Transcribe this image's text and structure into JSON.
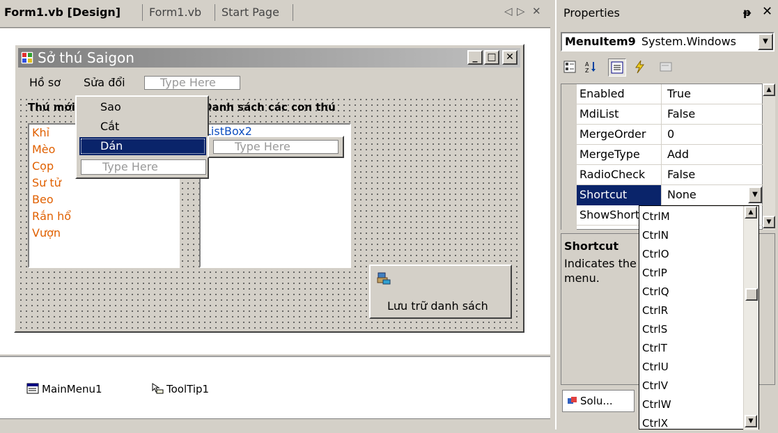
{
  "doc_tabs": {
    "tabs": [
      {
        "label": "Form1.vb [Design]"
      },
      {
        "label": "Form1.vb"
      },
      {
        "label": "Start Page"
      }
    ],
    "nav_left": "◁",
    "nav_right": "▷",
    "close": "✕"
  },
  "form": {
    "title": "Sở thú Saigon",
    "min": "_",
    "max": "□",
    "close": "✕",
    "menu": [
      "Hồ sơ",
      "Sửa đổi"
    ],
    "menu_type_here": "Type Here",
    "label_left": "Thú mới",
    "label_right": "Danh sách các con thú",
    "listbox1_items": [
      "Khỉ",
      "Mèo",
      "Cọp",
      "Sư tử",
      "Beo",
      "Rắn hổ",
      "Vượn"
    ],
    "listbox2_name": "ListBox2",
    "save_button": "Lưu trữ danh sách"
  },
  "edit_dropdown": {
    "items": [
      "Sao",
      "Cắt",
      "Dán"
    ],
    "selected_index": 2,
    "type_here": "Type Here",
    "submenu_type_here": "Type Here"
  },
  "tray": {
    "items": [
      {
        "label": "MainMenu1",
        "icon": "menu-icon"
      },
      {
        "label": "ToolTip1",
        "icon": "tooltip-icon"
      }
    ]
  },
  "properties": {
    "title": "Properties",
    "pin": "ᵽ",
    "close": "✕",
    "object_name": "MenuItem9",
    "object_type": "System.Windows",
    "rows": [
      {
        "name": "Enabled",
        "value": "True"
      },
      {
        "name": "MdiList",
        "value": "False"
      },
      {
        "name": "MergeOrder",
        "value": "0"
      },
      {
        "name": "MergeType",
        "value": "Add"
      },
      {
        "name": "RadioCheck",
        "value": "False"
      },
      {
        "name": "Shortcut",
        "value": "None"
      },
      {
        "name": "ShowShortcut",
        "value": ""
      }
    ],
    "selected_row": "Shortcut",
    "description_title": "Shortcut",
    "description_text": "Indicates the menu.",
    "solution_tab": "Solu..."
  },
  "shortcut_options": [
    "CtrlM",
    "CtrlN",
    "CtrlO",
    "CtrlP",
    "CtrlQ",
    "CtrlR",
    "CtrlS",
    "CtrlT",
    "CtrlU",
    "CtrlV",
    "CtrlW",
    "CtrlX"
  ],
  "colors": {
    "selection": "#0a246a",
    "list_text": "#e06000",
    "chrome": "#d4d0c8"
  }
}
